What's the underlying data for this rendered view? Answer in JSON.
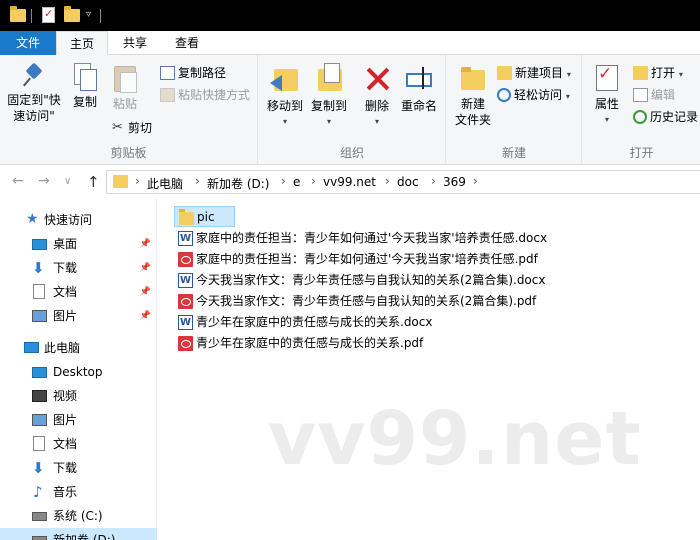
{
  "tabs": {
    "file": "文件",
    "home": "主页",
    "share": "共享",
    "view": "查看"
  },
  "ribbon": {
    "clipboard": {
      "label": "剪贴板",
      "pin_quick_access_1": "固定到\"快",
      "pin_quick_access_2": "速访问\"",
      "copy": "复制",
      "paste": "粘贴",
      "copy_path": "复制路径",
      "paste_shortcut": "粘贴快捷方式",
      "cut": "剪切"
    },
    "organize": {
      "label": "组织",
      "move_to": "移动到",
      "copy_to": "复制到",
      "delete": "删除",
      "rename": "重命名"
    },
    "new": {
      "label": "新建",
      "new_folder_1": "新建",
      "new_folder_2": "文件夹",
      "new_item": "新建项目",
      "easy_access": "轻松访问"
    },
    "open": {
      "label": "打开",
      "properties": "属性",
      "open": "打开",
      "edit": "编辑",
      "history": "历史记录"
    }
  },
  "nav": {
    "back": "←",
    "forward": "→",
    "recent": "∨",
    "up": "↑",
    "breadcrumb": [
      "此电脑",
      "新加卷 (D:)",
      "e",
      "vv99.net",
      "doc",
      "369"
    ]
  },
  "sidebar": {
    "quick_access": "快速访问",
    "quick_items": [
      "桌面",
      "下载",
      "文档",
      "图片"
    ],
    "this_pc": "此电脑",
    "pc_items": [
      "Desktop",
      "视频",
      "图片",
      "文档",
      "下载",
      "音乐",
      "系统 (C:)",
      "新加卷 (D:)"
    ]
  },
  "files": [
    {
      "name": "pic",
      "type": "folder"
    },
    {
      "name": "家庭中的责任担当：青少年如何通过'今天我当家'培养责任感.docx",
      "type": "word"
    },
    {
      "name": "家庭中的责任担当：青少年如何通过'今天我当家'培养责任感.pdf",
      "type": "pdf"
    },
    {
      "name": "今天我当家作文：青少年责任感与自我认知的关系(2篇合集).docx",
      "type": "word"
    },
    {
      "name": "今天我当家作文：青少年责任感与自我认知的关系(2篇合集).pdf",
      "type": "pdf"
    },
    {
      "name": "青少年在家庭中的责任感与成长的关系.docx",
      "type": "word"
    },
    {
      "name": "青少年在家庭中的责任感与成长的关系.pdf",
      "type": "pdf"
    }
  ],
  "watermark": "vv99.net",
  "colors": {
    "accent": "#1979ca",
    "selection": "#cce8ff",
    "folder": "#f3cd5f",
    "pdf": "#d9363e"
  }
}
